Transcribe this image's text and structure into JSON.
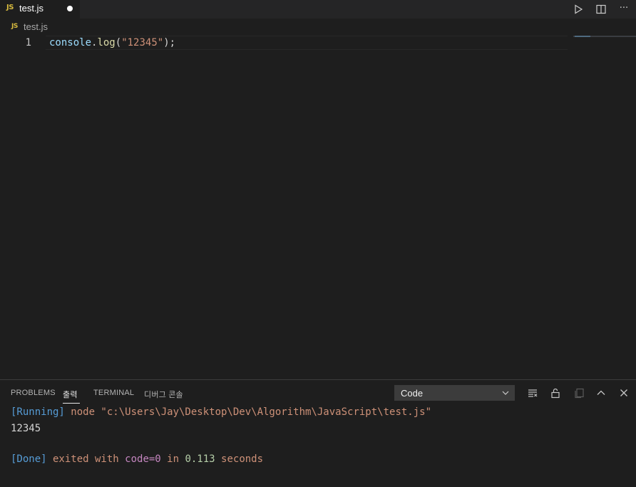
{
  "tab": {
    "badge": "JS",
    "filename": "test.js"
  },
  "toolbar": {
    "run_icon": "play-icon",
    "split_icon": "split-editor-icon",
    "more_label": "···"
  },
  "breadcrumb": {
    "badge": "JS",
    "filename": "test.js"
  },
  "editor": {
    "line_number": "1",
    "code": {
      "object": "console",
      "dot": ".",
      "method": "log",
      "open": "(",
      "string": "\"12345\"",
      "close": ");"
    }
  },
  "panel": {
    "tabs": [
      "PROBLEMS",
      "출력",
      "TERMINAL",
      "디버그 콘솔"
    ],
    "active_tab": "출력",
    "output_channel": "Code",
    "icons": [
      "clear-output-icon",
      "lock-icon",
      "copy-icon",
      "maximize-panel-icon",
      "close-panel-icon"
    ],
    "output": {
      "running_tag": "[Running]",
      "command": " node \"c:\\Users\\Jay\\Desktop\\Dev\\Algorithm\\JavaScript\\test.js\"",
      "result": "12345",
      "done_tag": "[Done]",
      "exited_with": " exited with ",
      "code_label": "code=0",
      "in_label": " in ",
      "seconds_value": "0.113",
      "seconds_label": " seconds"
    }
  },
  "colors": {
    "accent_js": "#d7ba3e",
    "string": "#ce9178",
    "keyword": "#569cd6"
  }
}
